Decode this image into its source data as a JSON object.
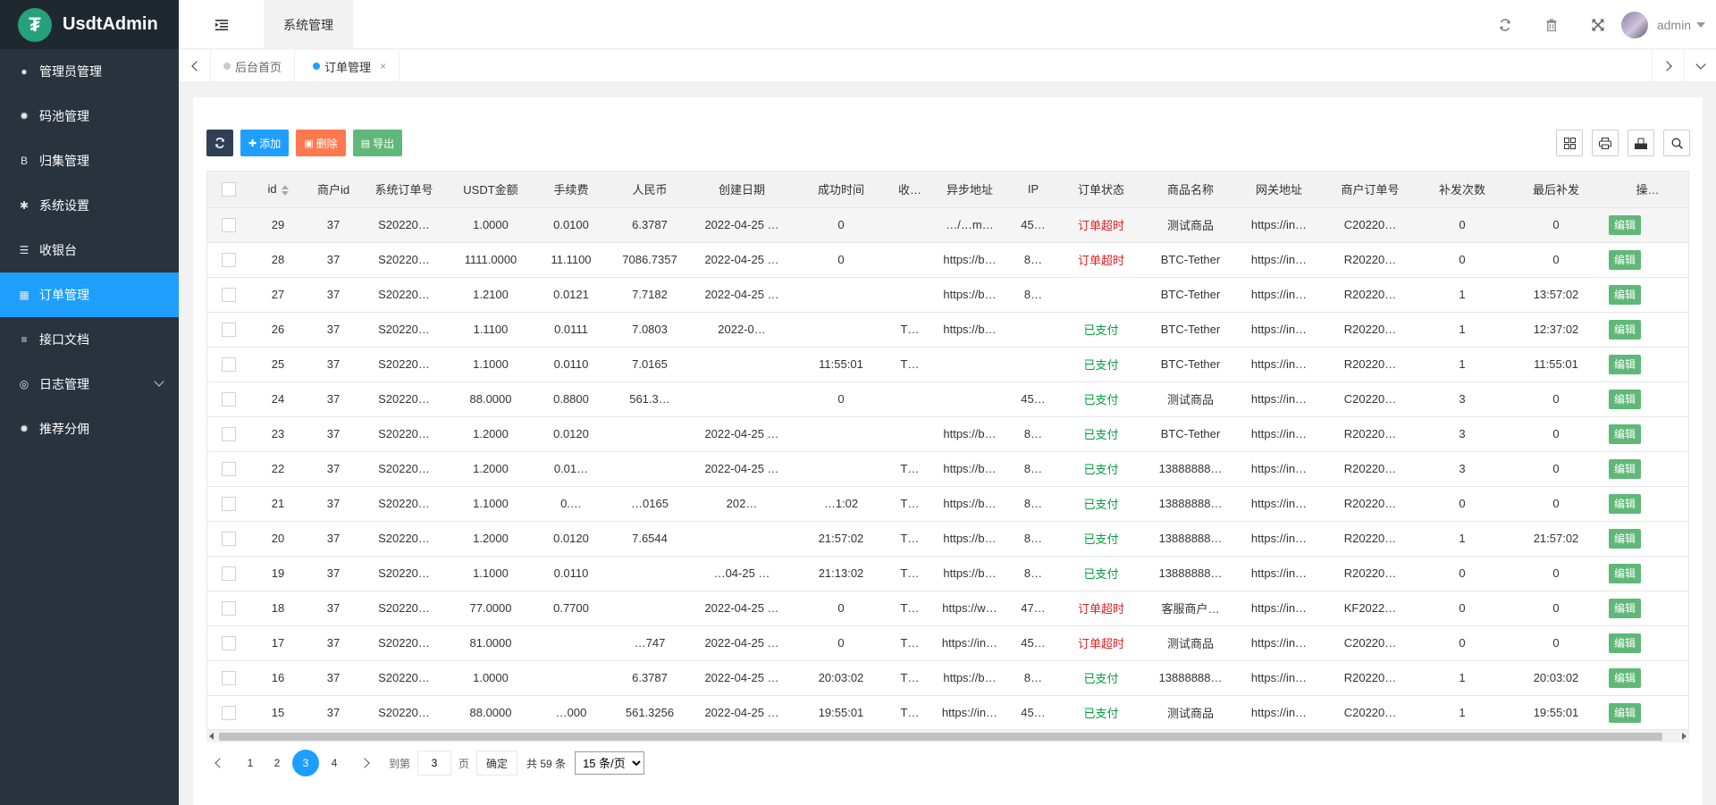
{
  "logo": {
    "mark": "₮",
    "name": "UsdtAdmin"
  },
  "sidebar": {
    "items": [
      {
        "label": "管理员管理",
        "icon": "user-icon"
      },
      {
        "label": "码池管理",
        "icon": "android-icon"
      },
      {
        "label": "归集管理",
        "icon": "bitcoin-icon"
      },
      {
        "label": "系统设置",
        "icon": "asterisk-icon"
      },
      {
        "label": "收银台",
        "icon": "list-icon"
      },
      {
        "label": "订单管理",
        "icon": "calculator-icon",
        "active": true
      },
      {
        "label": "接口文档",
        "icon": "align-left-icon"
      },
      {
        "label": "日志管理",
        "icon": "globe-icon",
        "expandable": true
      },
      {
        "label": "推荐分佣",
        "icon": "android-icon"
      }
    ]
  },
  "header": {
    "module_tab": "系统管理",
    "username": "admin"
  },
  "tabs": [
    {
      "label": "后台首页"
    },
    {
      "label": "订单管理",
      "active": true,
      "close": "×"
    }
  ],
  "toolbar": {
    "add": "添加",
    "delete": "删除",
    "export": "导出"
  },
  "table": {
    "columns": [
      "id",
      "商户id",
      "系统订单号",
      "USDT金额",
      "手续费",
      "人民币",
      "创建日期",
      "成功时间",
      "收…",
      "异步地址",
      "IP",
      "订单状态",
      "商品名称",
      "网关地址",
      "商户订单号",
      "补发次数",
      "最后补发",
      "操…"
    ],
    "edit_label": "编辑",
    "rows": [
      {
        "id": "29",
        "mid": "37",
        "sys_no": "S20220…",
        "usdt": "1.0000",
        "fee": "0.0100",
        "cny": "6.3787",
        "created": "2022-04-25 …",
        "success": "0",
        "recv": "",
        "notify": "…/…m…",
        "ip": "45…",
        "status": "订单超时",
        "st": "red",
        "product": "测试商品",
        "gateway": "https://in…",
        "merchant_no": "C20220…",
        "retries": "0",
        "last": "0"
      },
      {
        "id": "28",
        "mid": "37",
        "sys_no": "S20220…",
        "usdt": "1111.0000",
        "fee": "11.1100",
        "cny": "7086.7357",
        "created": "2022-04-25 …",
        "success": "0",
        "recv": "",
        "notify": "https://b…",
        "ip": "8…",
        "status": "订单超时",
        "st": "red",
        "product": "BTC-Tether",
        "gateway": "https://in…",
        "merchant_no": "R20220…",
        "retries": "0",
        "last": "0"
      },
      {
        "id": "27",
        "mid": "37",
        "sys_no": "S20220…",
        "usdt": "1.2100",
        "fee": "0.0121",
        "cny": "7.7182",
        "created": "2022-04-25 …",
        "success": "",
        "recv": "",
        "notify": "https://b…",
        "ip": "8…",
        "status": "",
        "st": "green",
        "product": "BTC-Tether",
        "gateway": "https://in…",
        "merchant_no": "R20220…",
        "retries": "1",
        "last": "13:57:02"
      },
      {
        "id": "26",
        "mid": "37",
        "sys_no": "S20220…",
        "usdt": "1.1100",
        "fee": "0.0111",
        "cny": "7.0803",
        "created": "2022-0…",
        "success": "",
        "recv": "T…",
        "notify": "https://b…",
        "ip": "",
        "status": "已支付",
        "st": "green",
        "product": "BTC-Tether",
        "gateway": "https://in…",
        "merchant_no": "R20220…",
        "retries": "1",
        "last": "12:37:02"
      },
      {
        "id": "25",
        "mid": "37",
        "sys_no": "S20220…",
        "usdt": "1.1000",
        "fee": "0.0110",
        "cny": "7.0165",
        "created": "",
        "success": "11:55:01",
        "recv": "T…",
        "notify": "",
        "ip": "",
        "status": "已支付",
        "st": "green",
        "product": "BTC-Tether",
        "gateway": "https://in…",
        "merchant_no": "R20220…",
        "retries": "1",
        "last": "11:55:01"
      },
      {
        "id": "24",
        "mid": "37",
        "sys_no": "S20220…",
        "usdt": "88.0000",
        "fee": "0.8800",
        "cny": "561.3…",
        "created": "",
        "success": "0",
        "recv": "",
        "notify": "",
        "ip": "45…",
        "status": "已支付",
        "st": "green",
        "product": "测试商品",
        "gateway": "https://in…",
        "merchant_no": "C20220…",
        "retries": "3",
        "last": "0"
      },
      {
        "id": "23",
        "mid": "37",
        "sys_no": "S20220…",
        "usdt": "1.2000",
        "fee": "0.0120",
        "cny": "",
        "created": "2022-04-25 …",
        "success": "",
        "recv": "",
        "notify": "https://b…",
        "ip": "8…",
        "status": "已支付",
        "st": "green",
        "product": "BTC-Tether",
        "gateway": "https://in…",
        "merchant_no": "R20220…",
        "retries": "3",
        "last": "0"
      },
      {
        "id": "22",
        "mid": "37",
        "sys_no": "S20220…",
        "usdt": "1.2000",
        "fee": "0.01…",
        "cny": "",
        "created": "2022-04-25 …",
        "success": "",
        "recv": "T…",
        "notify": "https://b…",
        "ip": "8…",
        "status": "已支付",
        "st": "green",
        "product": "13888888…",
        "gateway": "https://in…",
        "merchant_no": "R20220…",
        "retries": "3",
        "last": "0"
      },
      {
        "id": "21",
        "mid": "37",
        "sys_no": "S20220…",
        "usdt": "1.1000",
        "fee": "0.…",
        "cny": "…0165",
        "created": "202…",
        "success": "…1:02",
        "recv": "T…",
        "notify": "https://b…",
        "ip": "8…",
        "status": "已支付",
        "st": "green",
        "product": "13888888…",
        "gateway": "https://in…",
        "merchant_no": "R20220…",
        "retries": "0",
        "last": "0"
      },
      {
        "id": "20",
        "mid": "37",
        "sys_no": "S20220…",
        "usdt": "1.2000",
        "fee": "0.0120",
        "cny": "7.6544",
        "created": "",
        "success": "21:57:02",
        "recv": "T…",
        "notify": "https://b…",
        "ip": "8…",
        "status": "已支付",
        "st": "green",
        "product": "13888888…",
        "gateway": "https://in…",
        "merchant_no": "R20220…",
        "retries": "1",
        "last": "21:57:02"
      },
      {
        "id": "19",
        "mid": "37",
        "sys_no": "S20220…",
        "usdt": "1.1000",
        "fee": "0.0110",
        "cny": "",
        "created": "…04-25 …",
        "success": "21:13:02",
        "recv": "T…",
        "notify": "https://b…",
        "ip": "8…",
        "status": "已支付",
        "st": "green",
        "product": "13888888…",
        "gateway": "https://in…",
        "merchant_no": "R20220…",
        "retries": "0",
        "last": "0"
      },
      {
        "id": "18",
        "mid": "37",
        "sys_no": "S20220…",
        "usdt": "77.0000",
        "fee": "0.7700",
        "cny": "",
        "created": "2022-04-25 …",
        "success": "0",
        "recv": "T…",
        "notify": "https://w…",
        "ip": "47…",
        "status": "订单超时",
        "st": "red",
        "product": "客服商户…",
        "gateway": "https://in…",
        "merchant_no": "KF2022…",
        "retries": "0",
        "last": "0"
      },
      {
        "id": "17",
        "mid": "37",
        "sys_no": "S20220…",
        "usdt": "81.0000",
        "fee": "",
        "cny": "…747",
        "created": "2022-04-25 …",
        "success": "0",
        "recv": "T…",
        "notify": "https://in…",
        "ip": "45…",
        "status": "订单超时",
        "st": "red",
        "product": "测试商品",
        "gateway": "https://in…",
        "merchant_no": "C20220…",
        "retries": "0",
        "last": "0"
      },
      {
        "id": "16",
        "mid": "37",
        "sys_no": "S20220…",
        "usdt": "1.0000",
        "fee": "",
        "cny": "6.3787",
        "created": "2022-04-25 …",
        "success": "20:03:02",
        "recv": "T…",
        "notify": "https://b…",
        "ip": "8…",
        "status": "已支付",
        "st": "green",
        "product": "13888888…",
        "gateway": "https://in…",
        "merchant_no": "R20220…",
        "retries": "1",
        "last": "20:03:02"
      },
      {
        "id": "15",
        "mid": "37",
        "sys_no": "S20220…",
        "usdt": "88.0000",
        "fee": "…000",
        "cny": "561.3256",
        "created": "2022-04-25 …",
        "success": "19:55:01",
        "recv": "T…",
        "notify": "https://in…",
        "ip": "45…",
        "status": "已支付",
        "st": "green",
        "product": "测试商品",
        "gateway": "https://in…",
        "merchant_no": "C20220…",
        "retries": "1",
        "last": "19:55:01"
      }
    ]
  },
  "pagination": {
    "pages": [
      "1",
      "2",
      "3",
      "4"
    ],
    "current": "3",
    "goto_label": "到第",
    "goto_value": "3",
    "page_unit": "页",
    "confirm": "确定",
    "total": "共 59 条",
    "page_size": "15 条/页"
  },
  "colors": {
    "sidebar": "#28333e",
    "accent": "#1e9fff",
    "timeout": "#e02020",
    "paid": "#009f3c",
    "edit": "#5fb878"
  }
}
